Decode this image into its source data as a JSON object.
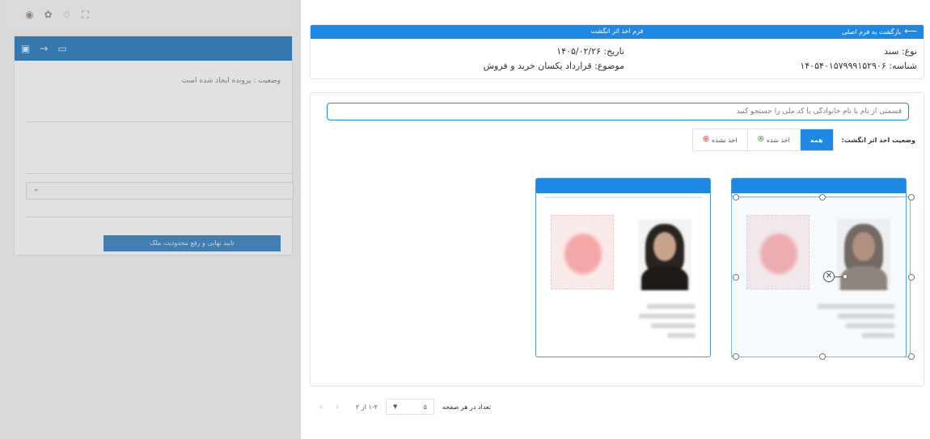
{
  "background_app": {
    "status_text": "وضعیت : پرونده ایجاد شده است",
    "confirm_button": "تایید نهایی و رفع محدودیت ملک",
    "select_caret": "⌄"
  },
  "header": {
    "back_label": "بازگشت به فرم اصلی",
    "back_arrow": "⟵",
    "title": "فرم اخذ اثر انگشت",
    "type": "نوع: سند",
    "id": "شناسه: ۱۴۰۵۴۰۱۵۷۹۹۹۱۵۲۹۰۶",
    "date": "تاریخ: ۱۴۰۵/۰۲/۲۶",
    "subject": "موضوع: قرارداد یکسان خرید و فروش"
  },
  "search": {
    "placeholder": "قسمتی از نام یا نام خانوادگی یا کد ملی را جستجو کنید"
  },
  "filter": {
    "label": "وضعیت اخذ اثر انگشت:",
    "options": [
      "همه",
      "اخذ شده",
      "اخذ نشده"
    ],
    "selected": "همه"
  },
  "persons": [
    {
      "fingerprint_color": "#f5a7a7",
      "hair_color": "#6b5a50",
      "face_color": "#b08870",
      "body_color": "#8a7a70"
    },
    {
      "fingerprint_color": "#f5a7a7",
      "hair_color": "#2a2420",
      "face_color": "#c9a28a",
      "body_color": "#1e1a18"
    }
  ],
  "pagination": {
    "range": "۱-۲ از ۲",
    "page_size": "۵",
    "page_size_label": "تعداد در هر صفحه",
    "prev": "‹",
    "next": "›"
  },
  "colors": {
    "accent": "#1e88e5",
    "taken": "#43a047",
    "not_taken": "#e53935"
  }
}
